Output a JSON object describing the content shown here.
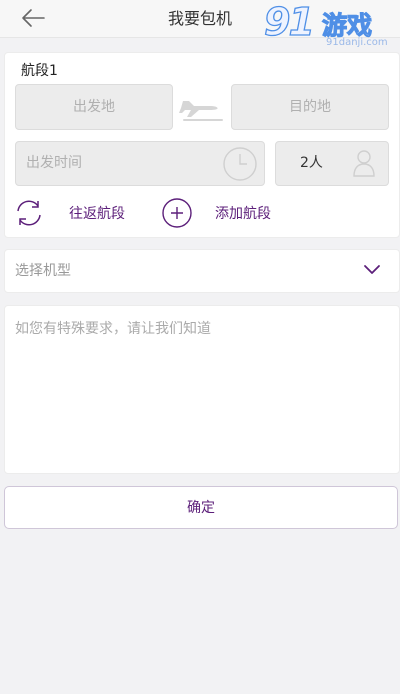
{
  "header": {
    "title": "我要包机",
    "back_icon": "arrow-left-icon"
  },
  "watermark": {
    "logo": "91游戏",
    "url": "91danji.com"
  },
  "segment": {
    "title": "航段1",
    "from_placeholder": "出发地",
    "to_placeholder": "目的地",
    "time_placeholder": "出发时间",
    "passengers": "2人"
  },
  "actions": {
    "round_trip": "往返航段",
    "add_segment": "添加航段"
  },
  "aircraft_type": {
    "placeholder": "选择机型"
  },
  "requirements": {
    "placeholder": "如您有特殊要求，请让我们知道"
  },
  "confirm_label": "确定",
  "colors": {
    "accent": "#5c1f7a",
    "background": "#f2f2f4",
    "field": "#ececec"
  }
}
